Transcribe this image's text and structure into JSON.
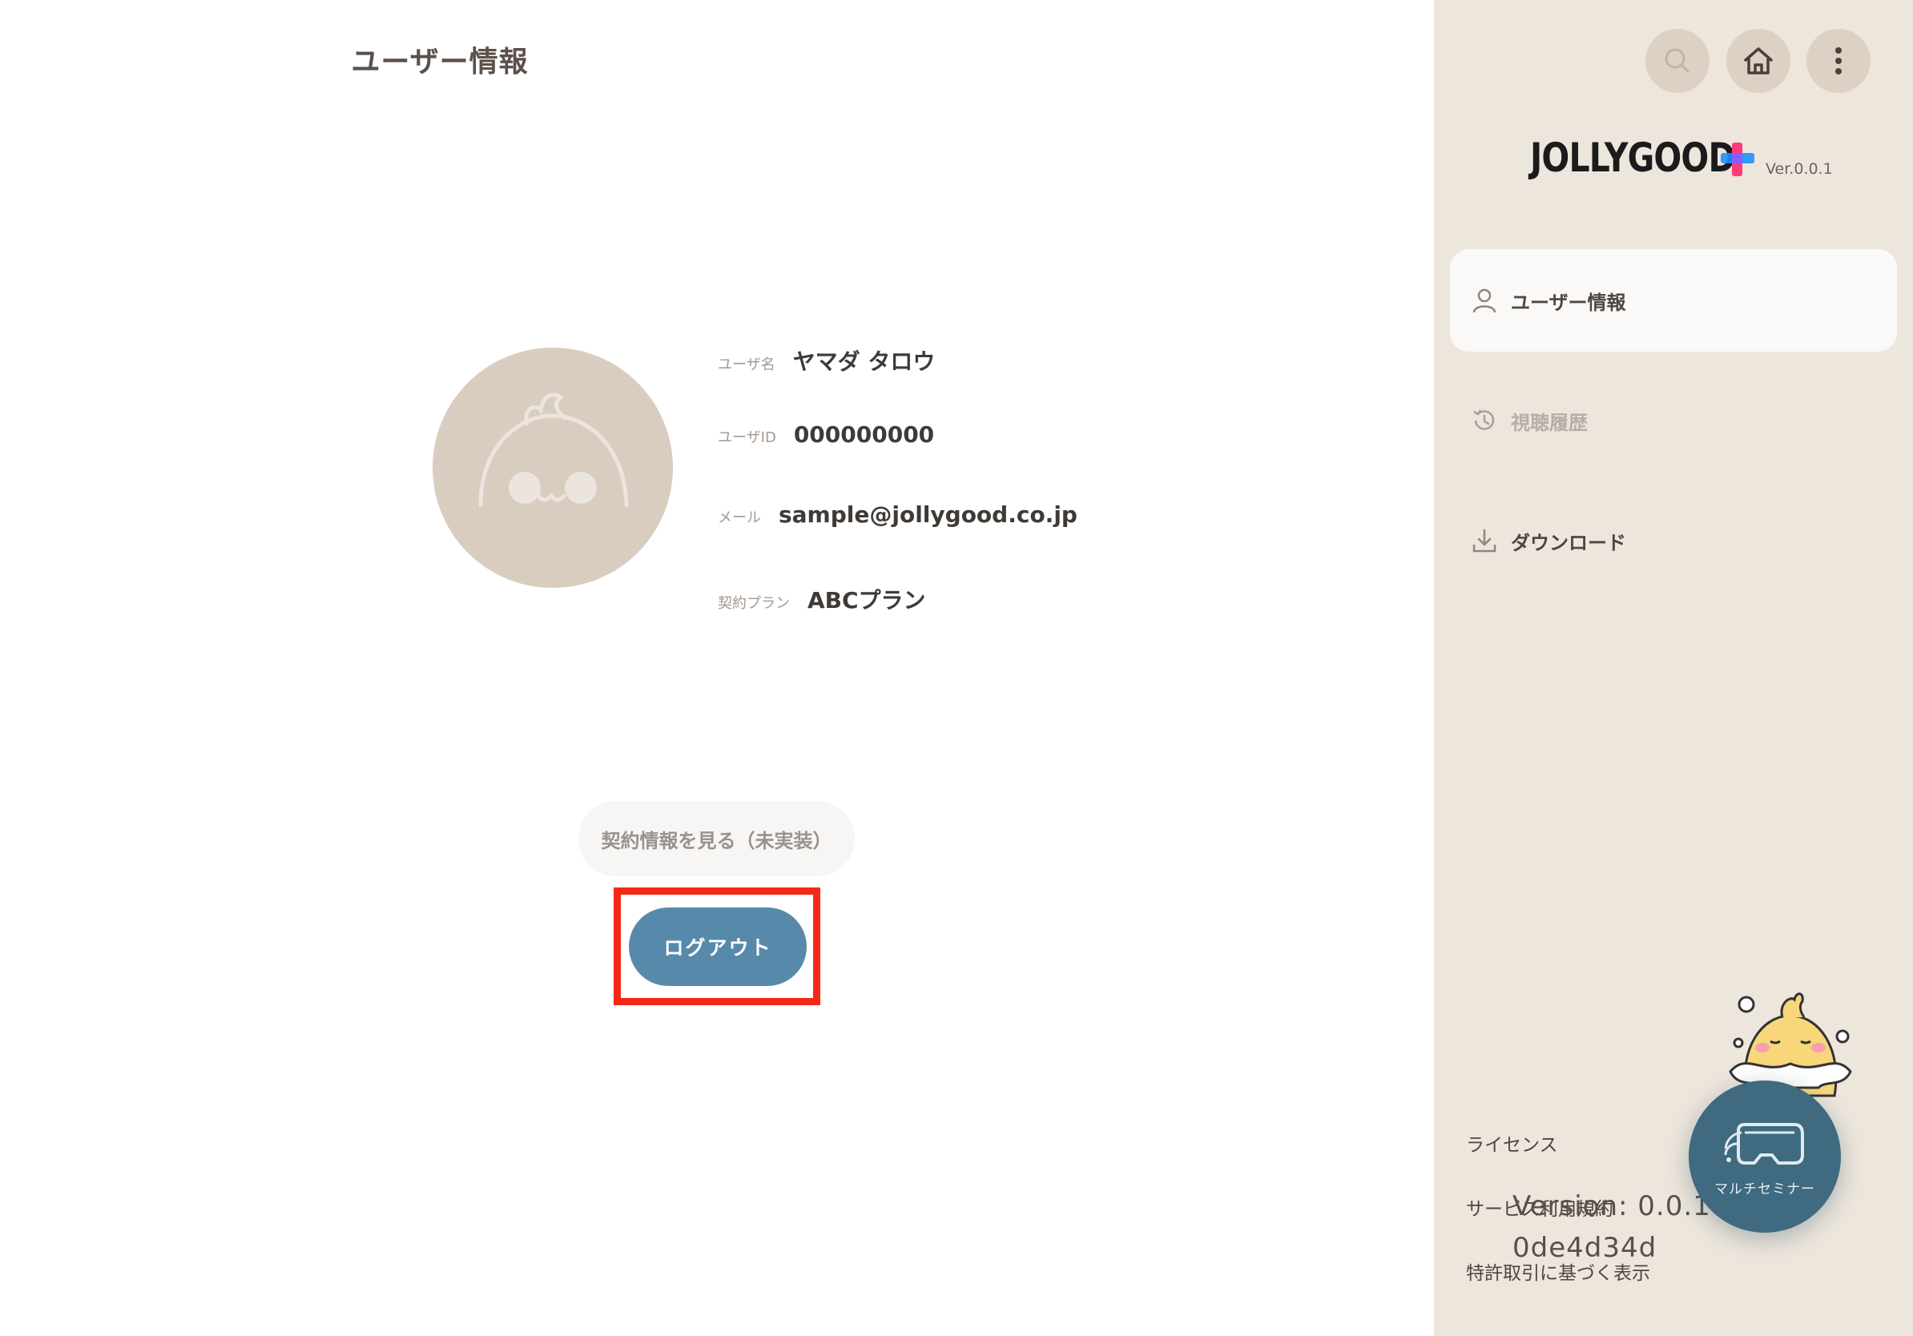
{
  "main": {
    "title": "ユーザー情報",
    "user_info": {
      "username_label": "ユーザ名",
      "username": "ヤマダ タロウ",
      "userid_label": "ユーザID",
      "userid": "000000000",
      "mail_label": "メール",
      "mail": "sample@jollygood.co.jp",
      "plan_label": "契約プラン",
      "plan": "ABCプラン"
    },
    "contract_button": "契約情報を見る（未実装）",
    "logout_button": "ログアウト"
  },
  "sidebar": {
    "top_buttons": [
      "search-icon",
      "home-icon",
      "more-vertical-icon"
    ],
    "logo": "JOLLYGOOD",
    "version_badge": "Ver.0.0.1",
    "nav": [
      {
        "label": "ユーザー情報",
        "icon": "user-icon",
        "active": true
      },
      {
        "label": "視聴履歴",
        "icon": "history-icon",
        "active": false
      },
      {
        "label": "ダウンロード",
        "icon": "download-icon",
        "active": false
      }
    ],
    "footer": {
      "license": "ライセンス",
      "service_terms": "サービス利用規約",
      "commerce_law": "特許取引に基づく表示",
      "version": "Version: 0.0.1",
      "build": "0de4d34d"
    },
    "fab_label": "マルチセミナー"
  },
  "colors": {
    "sidebar_bg": "#ede6dc",
    "logout_bg": "#578aaa",
    "highlight": "#f62817",
    "fab_bg": "#3f6a7f",
    "logo_plus_blue": "#1e90ff",
    "logo_plus_pink": "#ff3b7a"
  }
}
